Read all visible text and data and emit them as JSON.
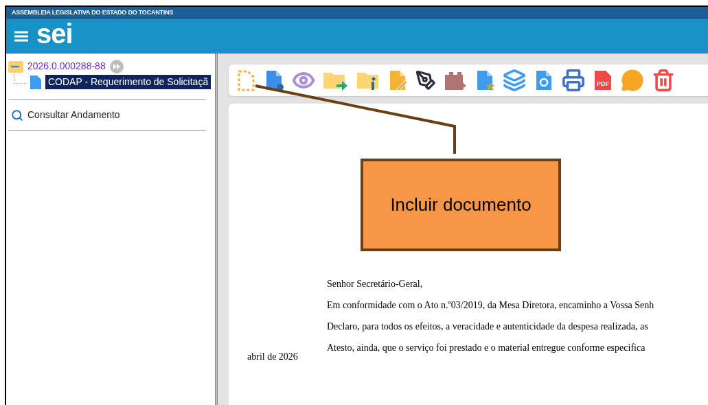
{
  "agency_bar": {
    "title": "ASSEMBLEIA LEGISLATIVA DO ESTADO DO TOCANTINS"
  },
  "header": {
    "logo": "sei"
  },
  "tree": {
    "process": {
      "number": "2026.0.000288-88",
      "children": [
        {
          "label": "CODAP - Requerimento de Solicitaçã",
          "selected": true
        }
      ]
    }
  },
  "side_menu": [
    {
      "label": "Consultar Andamento",
      "selected": false
    }
  ],
  "toolbar": {
    "pdf_label": "PDF"
  },
  "callout": {
    "text": "Incluir documento"
  },
  "document": {
    "greeting": "Senhor Secretário-Geral,",
    "paragraphs": [
      "Em conformidade com o Ato n.º03/2019, da Mesa Diretora, encaminho a Vossa Senh",
      "Declaro, para todos os efeitos, a veracidade e autenticidade da despesa realizada, as",
      "Atesto, ainda, que o serviço foi prestado e o material entregue conforme especifica"
    ],
    "date": "abril de 2026"
  }
}
